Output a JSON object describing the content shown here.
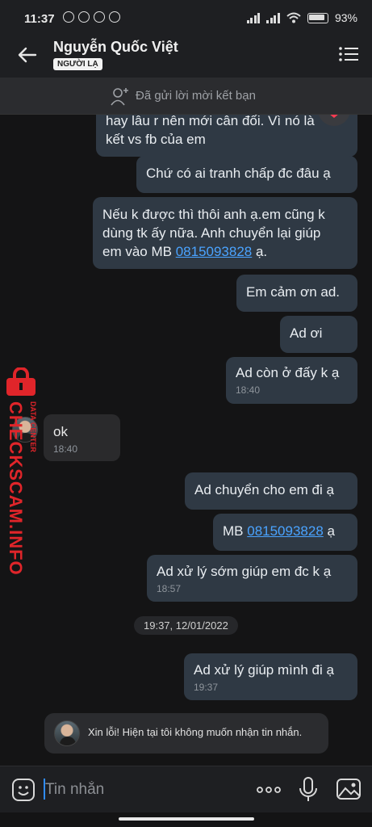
{
  "status_bar": {
    "time": "11:37",
    "battery": "93%"
  },
  "header": {
    "contact_name": "Nguyễn Quốc Việt",
    "badge": "NGƯỜI LẠ"
  },
  "friend_request": {
    "label": "Đã gửi lời mời kết bạn"
  },
  "messages": [
    {
      "line1": "hay lâu r nên mới cân đối. Vì nó là",
      "line2": "kết vs fb của em"
    },
    {
      "text": "Chứ có ai tranh chấp đc đâu ạ"
    },
    {
      "line1": "Nếu k được thì thôi anh ạ.em cũng k",
      "line2": "dùng tk ấy nữa. Anh chuyển lại giúp",
      "line3_prefix": "em vào MB ",
      "phone": "0815093828",
      "line3_suffix": " ạ."
    },
    {
      "text": "Em cảm ơn ad."
    },
    {
      "text": "Ad ơi"
    },
    {
      "text": "Ad còn ở đấy k ạ",
      "time": "18:40"
    },
    {
      "text": "ok",
      "time": "18:40"
    },
    {
      "text": "Ad chuyển cho em đi ạ"
    },
    {
      "prefix": "MB ",
      "phone": "0815093828",
      "suffix": " ạ"
    },
    {
      "text": "Ad xử lý sớm giúp em đc k ạ",
      "time": "18:57"
    },
    {
      "text": "Ad xử lý giúp mình đi ạ",
      "time": "19:37"
    }
  ],
  "date_separator": "19:37, 12/01/2022",
  "system_message": "Xin lỗi! Hiện tại tôi không muốn nhận tin nhắn.",
  "watermark": {
    "brand": "CHECKSCAM.INFO",
    "sub": "DATA CENTER"
  },
  "input": {
    "placeholder": "Tin nhắn"
  },
  "icons": {
    "back": "back-arrow-icon",
    "menu": "menu-icon",
    "add_friend": "add-friend-icon",
    "reaction": "heart-icon",
    "emoji": "emoji-icon",
    "more": "more-icon",
    "mic": "microphone-icon",
    "image": "image-icon"
  },
  "colors": {
    "my_bubble": "#2f3944",
    "their_bubble": "#2a2a2c",
    "link": "#4aa3ff",
    "watermark": "#e0252a",
    "reaction_heart": "#ff3b52"
  }
}
